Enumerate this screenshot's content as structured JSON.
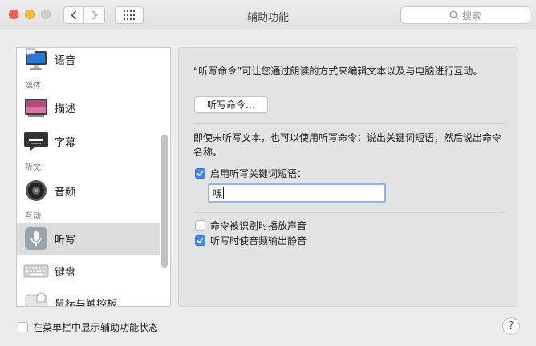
{
  "window": {
    "title": "辅助功能"
  },
  "search": {
    "placeholder": "搜索"
  },
  "sidebar": {
    "items": [
      {
        "label": "语音",
        "icon": "speech-monitor-icon"
      },
      {
        "label": "描述",
        "icon": "description-icon"
      },
      {
        "label": "字幕",
        "icon": "captions-icon"
      },
      {
        "label": "音频",
        "icon": "speaker-icon"
      },
      {
        "label": "听写",
        "icon": "microphone-icon",
        "selected": true
      },
      {
        "label": "键盘",
        "icon": "keyboard-icon"
      },
      {
        "label": "鼠标与触控板",
        "icon": "mouse-icon"
      }
    ],
    "headers": {
      "media": "媒体",
      "hearing": "听觉",
      "interaction": "互动"
    }
  },
  "main": {
    "intro": "“听写命令”可让您通过朗读的方式来编辑文本以及与电脑进行互动。",
    "commands_button": "听写命令…",
    "keyword_desc": "即使未听写文本，也可以使用听写命令：说出关键词短语，然后说出命令名称。",
    "enable_keyword": {
      "label": "启用听写关键词短语：",
      "checked": true
    },
    "keyword_value": "嘿",
    "play_sound": {
      "label": "命令被识别时播放声音",
      "checked": false
    },
    "mute_audio": {
      "label": "听写时使音频输出静音",
      "checked": true
    }
  },
  "footer": {
    "show_status": {
      "label": "在菜单栏中显示辅助功能状态",
      "checked": false
    }
  },
  "colors": {
    "accent": "#3d8bf7",
    "selection": "#dcdcdc"
  }
}
